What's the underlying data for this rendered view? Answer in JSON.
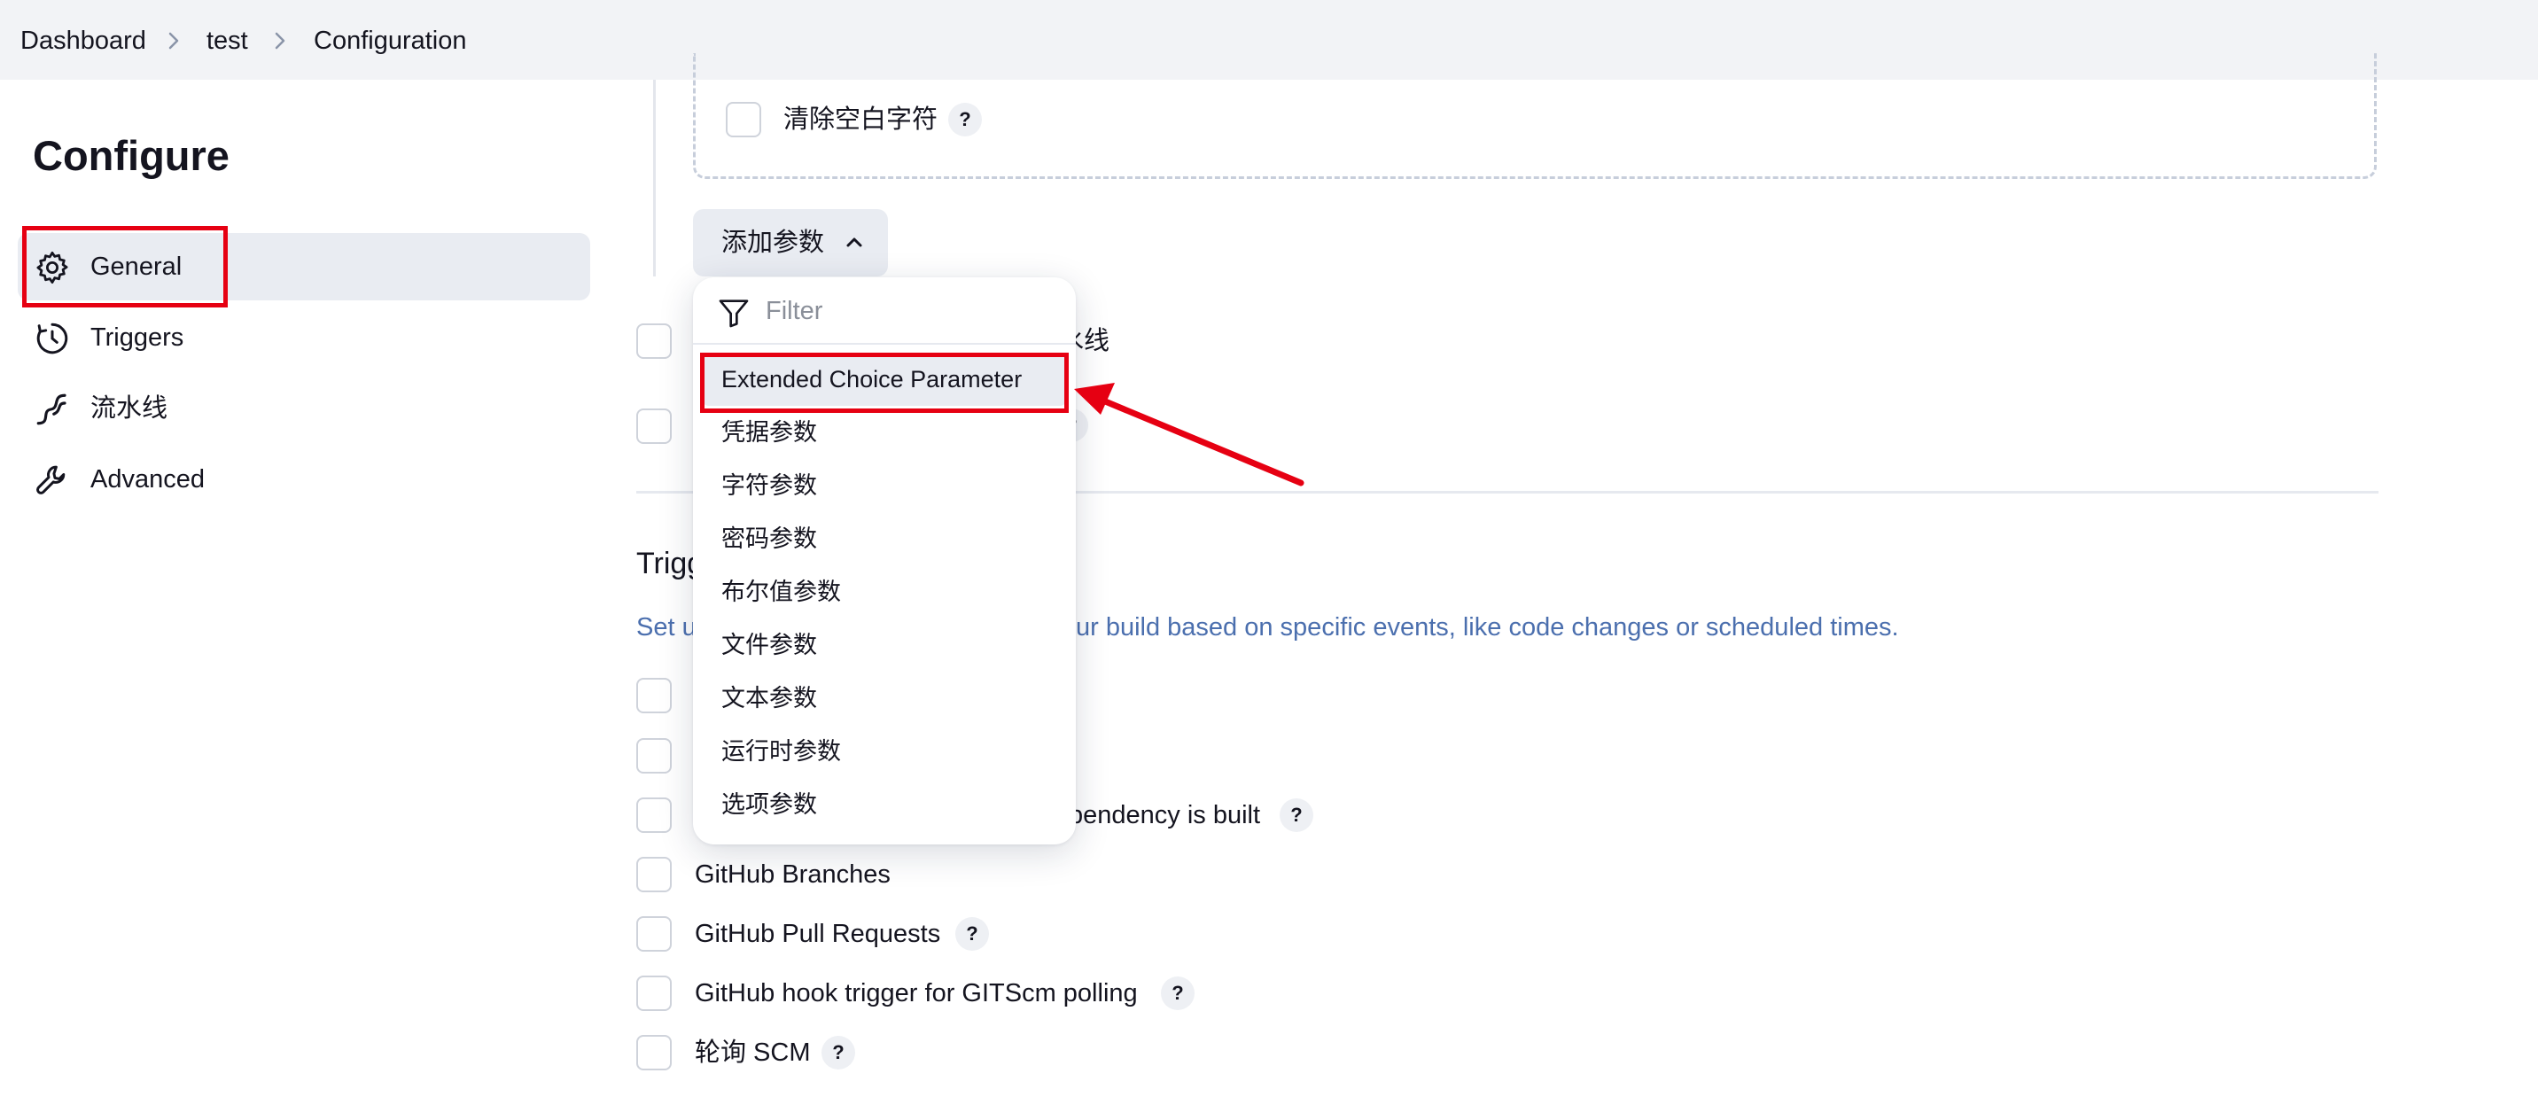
{
  "breadcrumb": {
    "items": [
      "Dashboard",
      "test",
      "Configuration"
    ]
  },
  "sidebar": {
    "title": "Configure",
    "items": [
      {
        "label": "General",
        "icon": "gear-icon",
        "active": true
      },
      {
        "label": "Triggers",
        "icon": "clock-icon"
      },
      {
        "label": "流水线",
        "icon": "pipeline-icon"
      },
      {
        "label": "Advanced",
        "icon": "wrench-icon"
      }
    ]
  },
  "params": {
    "trim_label": "清除空白字符",
    "help": "?",
    "add_button": "添加参数",
    "hidden_option_suffix": "水线"
  },
  "dropdown": {
    "filter_placeholder": "Filter",
    "items": [
      "Extended Choice Parameter",
      "凭据参数",
      "字符参数",
      "密码参数",
      "布尔值参数",
      "文件参数",
      "文本参数",
      "运行时参数",
      "选项参数"
    ],
    "highlighted": "Extended Choice Parameter"
  },
  "triggers": {
    "heading_visible": "Trigg",
    "desc_left": "Set u",
    "desc_right": "ur build based on specific events, like code changes or scheduled times.",
    "options": [
      {
        "label": ""
      },
      {
        "label": ""
      },
      {
        "label": "pendency is built",
        "help": true
      },
      {
        "label": "GitHub Branches",
        "help": false
      },
      {
        "label": "GitHub Pull Requests",
        "help": true
      },
      {
        "label": "GitHub hook trigger for GITScm polling",
        "help": true
      },
      {
        "label": "轮询 SCM",
        "help": true
      }
    ]
  },
  "colors": {
    "annotation_red": "#e60012",
    "link_blue": "#4b6fae",
    "active_bg": "#e9ecf2"
  }
}
